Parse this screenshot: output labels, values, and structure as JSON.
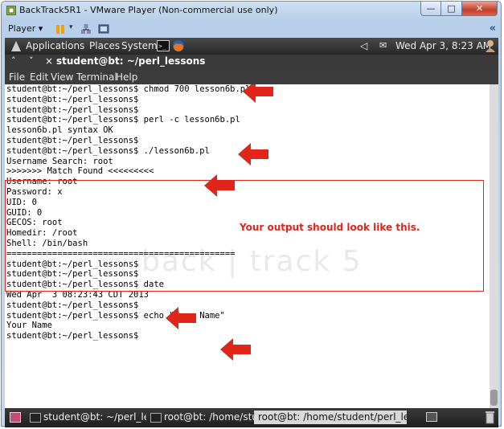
{
  "window": {
    "title": "BackTrack5R1 - VMware Player (Non-commercial use only)",
    "controls": [
      "minimize",
      "maximize",
      "close"
    ]
  },
  "vmware_toolbar": {
    "player_label": "Player",
    "icons": [
      "pause-icon",
      "network-icon",
      "unity-icon"
    ]
  },
  "gnome_panel": {
    "menus": [
      "Applications",
      "Places",
      "System"
    ],
    "clock": "Wed Apr  3,  8:23 AM"
  },
  "terminal": {
    "title": "student@bt: ~/perl_lessons",
    "menu": [
      "File",
      "Edit",
      "View",
      "Terminal",
      "Help"
    ],
    "lines": [
      "student@bt:~/perl_lessons$ chmod 700 lesson6b.pl",
      "student@bt:~/perl_lessons$",
      "student@bt:~/perl_lessons$",
      "student@bt:~/perl_lessons$ perl -c lesson6b.pl",
      "lesson6b.pl syntax OK",
      "student@bt:~/perl_lessons$",
      "student@bt:~/perl_lessons$ ./lesson6b.pl",
      "Username Search: root",
      ">>>>>>> Match Found <<<<<<<<<",
      "Username: root",
      "Password: x",
      "UID: 0",
      "GUID: 0",
      "GECOS: root",
      "Homedir: /root",
      "Shell: /bin/bash",
      "=============================================",
      "student@bt:~/perl_lessons$",
      "student@bt:~/perl_lessons$",
      "student@bt:~/perl_lessons$ date",
      "Wed Apr  3 08:23:43 CDT 2013",
      "student@bt:~/perl_lessons$",
      "student@bt:~/perl_lessons$ echo \"Your Name\"",
      "Your Name",
      "student@bt:~/perl_lessons$"
    ],
    "watermark": "back | track 5"
  },
  "annotation": {
    "note": "Your output should look like this.",
    "color": "#e1251b"
  },
  "taskbar": {
    "items": [
      "student@bt: ~/perl_le...",
      "root@bt: /home/studer",
      "root@bt: /home/student/perl_lessons"
    ]
  }
}
